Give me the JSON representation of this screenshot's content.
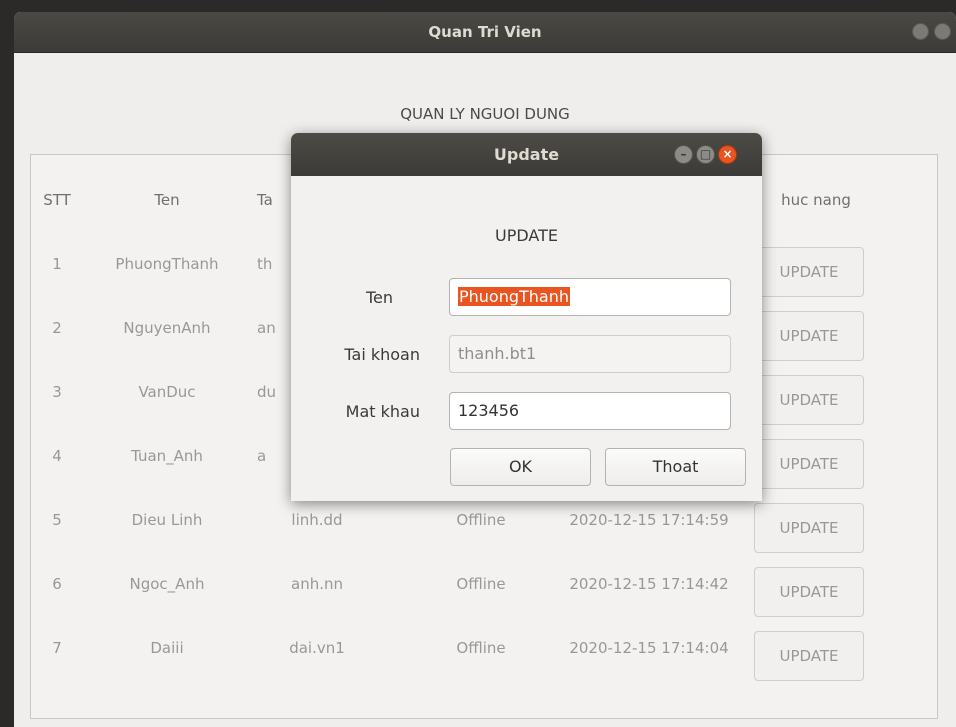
{
  "main_window": {
    "title": "Quan Tri Vien",
    "heading": "QUAN LY NGUOI DUNG"
  },
  "table": {
    "headers": {
      "stt": "STT",
      "ten": "Ten",
      "tai_khoan": "Ta",
      "chuc_nang": "huc nang"
    },
    "rows": [
      {
        "stt": "1",
        "ten": "PhuongThanh",
        "tai_khoan": "th",
        "trang_thai": "",
        "thoi_gian": "",
        "action": "UPDATE"
      },
      {
        "stt": "2",
        "ten": "NguyenAnh",
        "tai_khoan": "an",
        "trang_thai": "",
        "thoi_gian": "",
        "action": "UPDATE"
      },
      {
        "stt": "3",
        "ten": "VanDuc",
        "tai_khoan": "du",
        "trang_thai": "",
        "thoi_gian": "",
        "action": "UPDATE"
      },
      {
        "stt": "4",
        "ten": "Tuan_Anh",
        "tai_khoan": "a",
        "trang_thai": "",
        "thoi_gian": "",
        "action": "UPDATE"
      },
      {
        "stt": "5",
        "ten": "Dieu Linh",
        "tai_khoan": "linh.dd",
        "trang_thai": "Offline",
        "thoi_gian": "2020-12-15 17:14:59",
        "action": "UPDATE"
      },
      {
        "stt": "6",
        "ten": "Ngoc_Anh",
        "tai_khoan": "anh.nn",
        "trang_thai": "Offline",
        "thoi_gian": "2020-12-15 17:14:42",
        "action": "UPDATE"
      },
      {
        "stt": "7",
        "ten": "Daiii",
        "tai_khoan": "dai.vn1",
        "trang_thai": "Offline",
        "thoi_gian": "2020-12-15 17:14:04",
        "action": "UPDATE"
      }
    ]
  },
  "dialog": {
    "title": "Update",
    "heading": "UPDATE",
    "labels": {
      "ten": "Ten",
      "tai_khoan": "Tai khoan",
      "mat_khau": "Mat khau"
    },
    "values": {
      "ten": "PhuongThanh",
      "tai_khoan": "thanh.bt1",
      "mat_khau": "123456"
    },
    "ok_label": "OK",
    "thoat_label": "Thoat"
  },
  "colors": {
    "accent": "#e95420",
    "titlebar": "#3c3b37"
  },
  "icons": {
    "minimize": "minimize-icon",
    "maximize": "maximize-icon",
    "close": "close-icon"
  }
}
